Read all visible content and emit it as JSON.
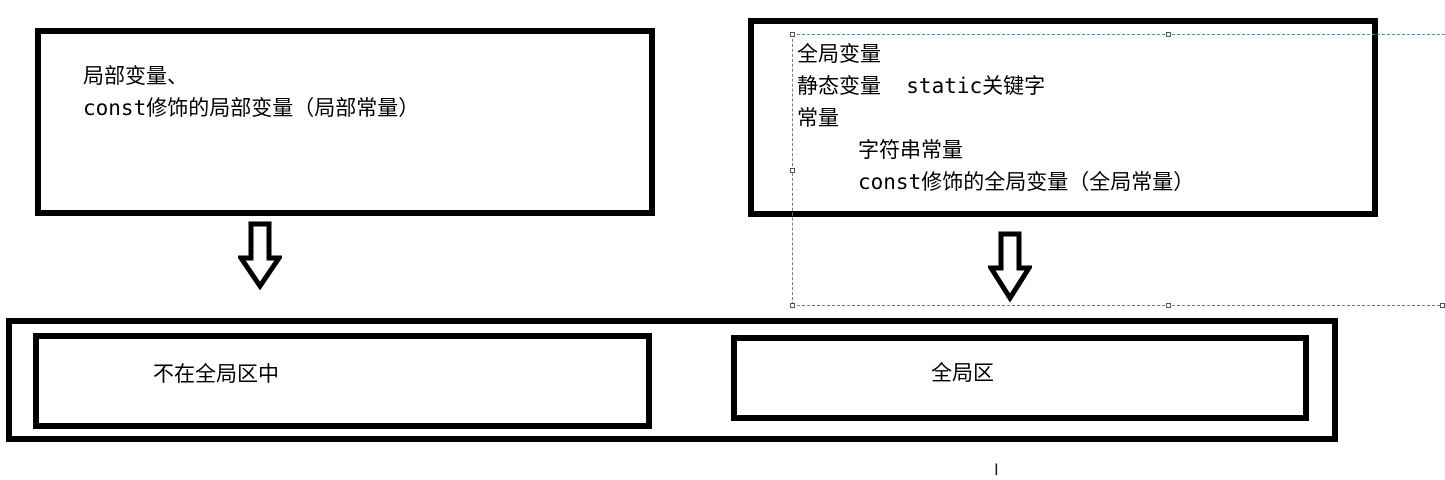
{
  "local_box": {
    "lines": [
      "局部变量、",
      "const修饰的局部变量（局部常量）"
    ]
  },
  "global_box": {
    "lines": [
      "全局变量",
      "静态变量  static关键字",
      "常量"
    ],
    "sub_lines": [
      "字符串常量",
      "const修饰的全局变量（全局常量）"
    ]
  },
  "memory": {
    "left_label": "不在全局区中",
    "right_label": "全局区"
  },
  "cursor_icon": "text-cursor-icon"
}
